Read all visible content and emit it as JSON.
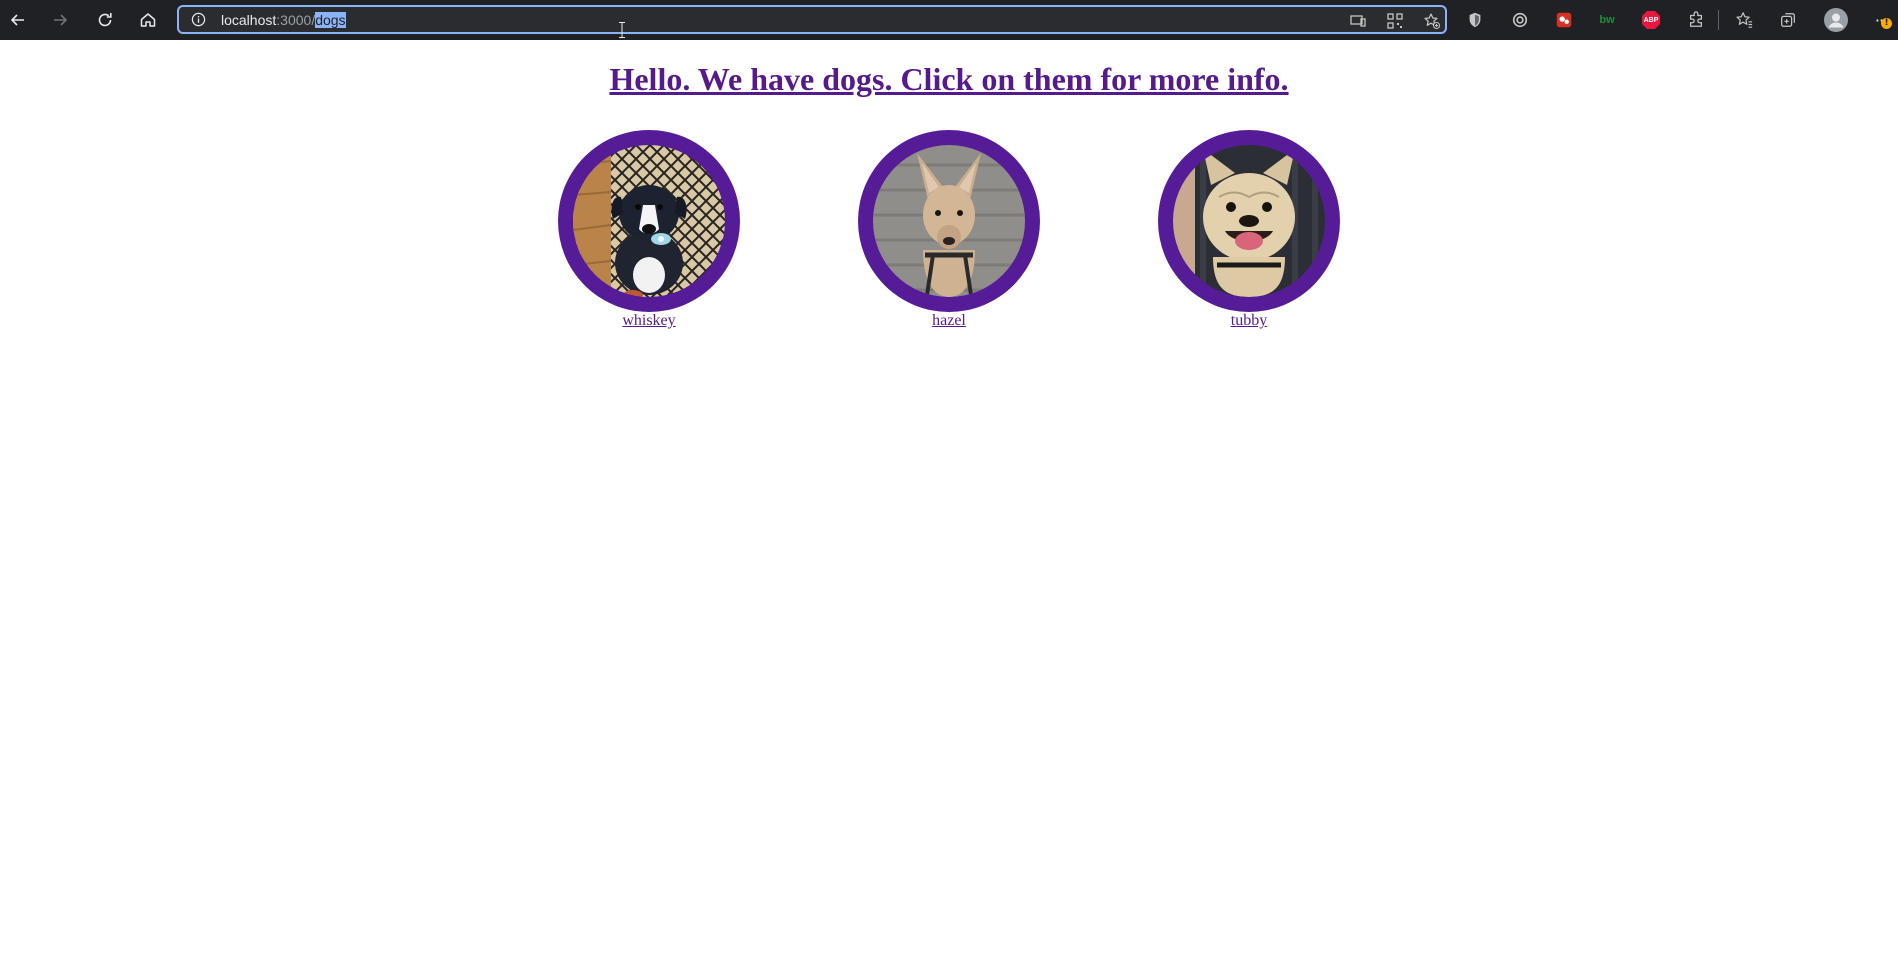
{
  "browser": {
    "url_host": "localhost",
    "url_port": ":3000",
    "url_slash": "/",
    "url_path_selected": "dogs",
    "extensions": [
      "shield-icon",
      "target-icon",
      "red-extension-icon",
      "bw-icon",
      "abp-icon",
      "puzzle-icon"
    ],
    "abp_label": "ABP",
    "bw_label": "bw",
    "notification_badge": "!"
  },
  "page": {
    "headline": "Hello. We have dogs. Click on them for more info.",
    "dogs": [
      {
        "name": "whiskey"
      },
      {
        "name": "hazel"
      },
      {
        "name": "tubby"
      }
    ]
  },
  "colors": {
    "ring": "#561c98",
    "link": "#551a8b",
    "toolbar": "#202124",
    "focus": "#8ab4f8"
  }
}
